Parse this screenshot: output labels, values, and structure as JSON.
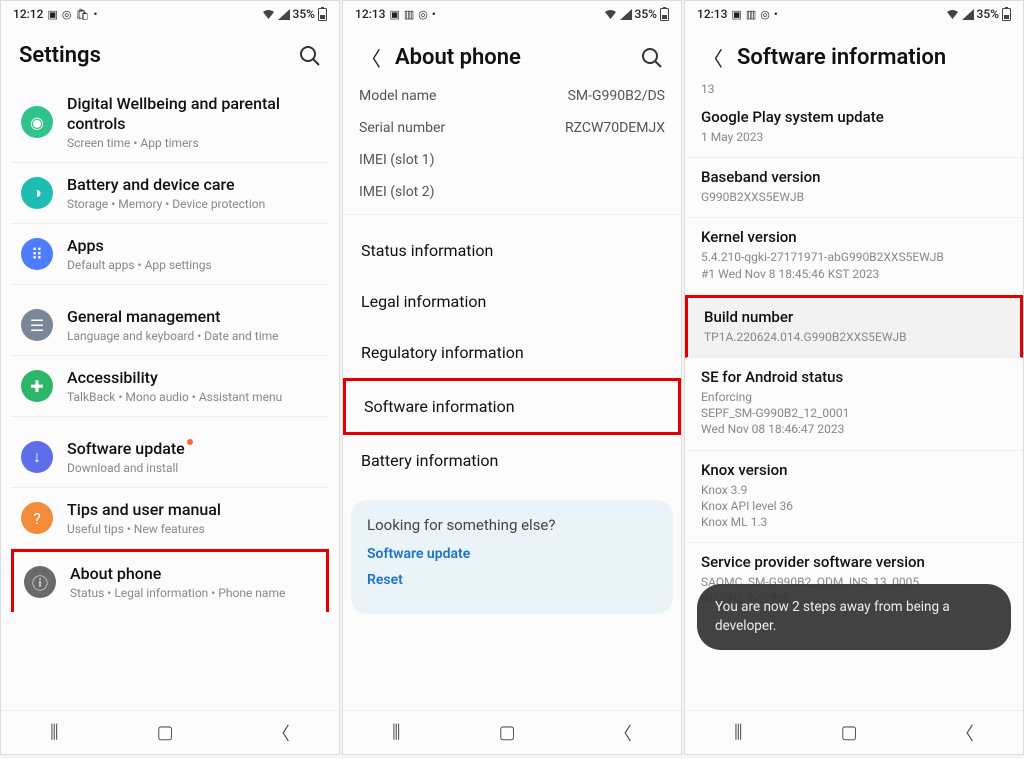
{
  "screen1": {
    "status": {
      "time": "12:12",
      "battery": "35%"
    },
    "header": {
      "title": "Settings"
    },
    "items": [
      {
        "title": "Digital Wellbeing and parental controls",
        "sub": "Screen time  •  App timers"
      },
      {
        "title": "Battery and device care",
        "sub": "Storage  •  Memory  •  Device protection"
      },
      {
        "title": "Apps",
        "sub": "Default apps  •  App settings"
      },
      {
        "title": "General management",
        "sub": "Language and keyboard  •  Date and time"
      },
      {
        "title": "Accessibility",
        "sub": "TalkBack  •  Mono audio  •  Assistant menu"
      },
      {
        "title": "Software update",
        "sub": "Download and install"
      },
      {
        "title": "Tips and user manual",
        "sub": "Useful tips  •  New features"
      },
      {
        "title": "About phone",
        "sub": "Status  •  Legal information  •  Phone name"
      }
    ]
  },
  "screen2": {
    "status": {
      "time": "12:13",
      "battery": "35%"
    },
    "header": {
      "title": "About phone"
    },
    "kv": [
      {
        "k": "Model name",
        "v": "SM-G990B2/DS"
      },
      {
        "k": "Serial number",
        "v": "RZCW70DEMJX"
      },
      {
        "k": "IMEI (slot 1)",
        "v": ""
      },
      {
        "k": "IMEI (slot 2)",
        "v": ""
      }
    ],
    "list": [
      "Status information",
      "Legal information",
      "Regulatory information",
      "Software information",
      "Battery information"
    ],
    "suggest": {
      "title": "Looking for something else?",
      "links": [
        "Software update",
        "Reset"
      ]
    }
  },
  "screen3": {
    "status": {
      "time": "12:13",
      "battery": "35%"
    },
    "header": {
      "title": "Software information"
    },
    "topline": "13",
    "blocks": [
      {
        "title": "Google Play system update",
        "sub": "1 May 2023"
      },
      {
        "title": "Baseband version",
        "sub": "G990B2XXS5EWJB"
      },
      {
        "title": "Kernel version",
        "sub": "5.4.210-qgki-27171971-abG990B2XXS5EWJB\n#1 Wed Nov 8 18:45:46 KST 2023"
      },
      {
        "title": "Build number",
        "sub": "TP1A.220624.014.G990B2XXS5EWJB"
      },
      {
        "title": "SE for Android status",
        "sub": "Enforcing\nSEPF_SM-G990B2_12_0001\nWed Nov 08 18:46:47 2023"
      },
      {
        "title": "Knox version",
        "sub": "Knox 3.9\nKnox API level 36\nKnox ML 1.3"
      },
      {
        "title": "Service provider software version",
        "sub": "SAOMC_SM-G990B2_ODM_INS_13_0005\nINS/INS,INS/INS"
      }
    ],
    "toast": "You are now 2 steps away from being a developer."
  }
}
